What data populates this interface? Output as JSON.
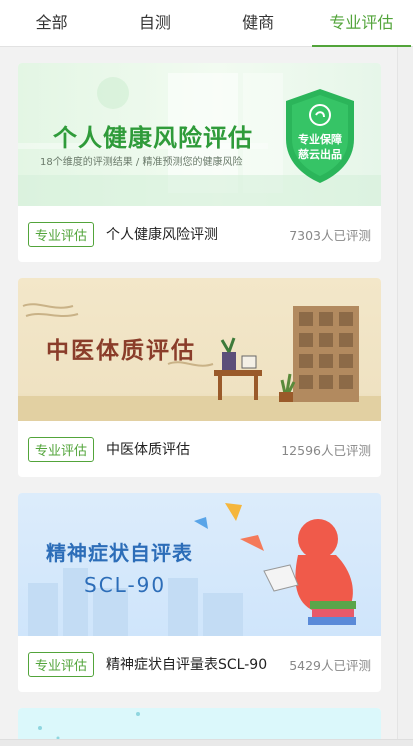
{
  "tabs": [
    {
      "label": "全部",
      "active": false
    },
    {
      "label": "自测",
      "active": false
    },
    {
      "label": "健商",
      "active": false
    },
    {
      "label": "专业评估",
      "active": true
    }
  ],
  "cards": [
    {
      "banner_title": "个人健康风险评估",
      "banner_subtitle": "18个维度的评测结果 / 精准预测您的健康风险",
      "badge_line1": "专业保障",
      "badge_line2": "慈云出品",
      "tag": "专业评估",
      "title": "个人健康风险评测",
      "count": "7303人已评测"
    },
    {
      "banner_title": "中医体质评估",
      "tag": "专业评估",
      "title": "中医体质评估",
      "count": "12596人已评测"
    },
    {
      "banner_title": "精神症状自评表",
      "banner_subtitle": "SCL-90",
      "tag": "专业评估",
      "title": "精神症状自评量表SCL-90",
      "count": "5429人已评测"
    }
  ],
  "colors": {
    "accent": "#52a43a"
  }
}
